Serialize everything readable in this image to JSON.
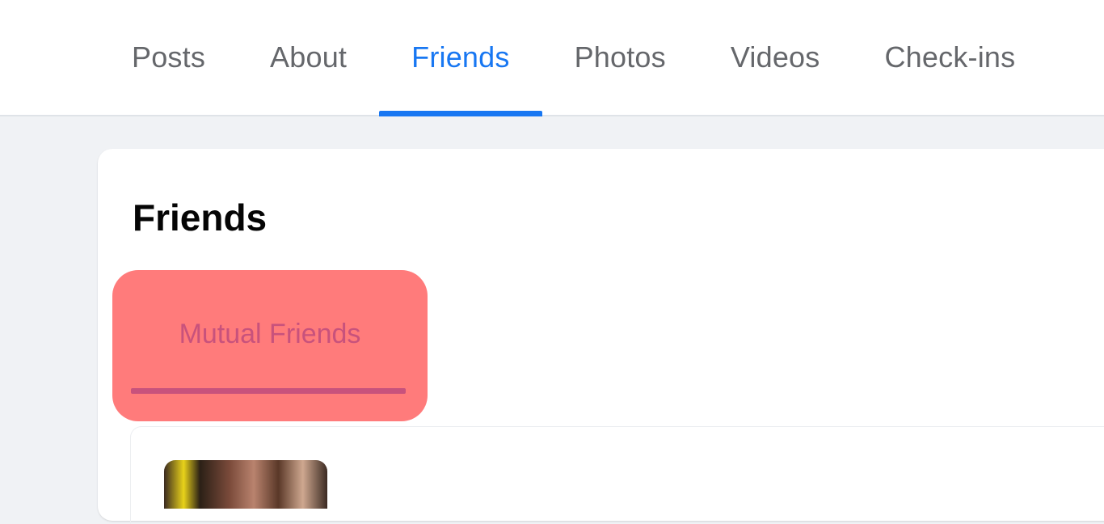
{
  "nav": {
    "tabs": [
      {
        "label": "Posts"
      },
      {
        "label": "About"
      },
      {
        "label": "Friends"
      },
      {
        "label": "Photos"
      },
      {
        "label": "Videos"
      },
      {
        "label": "Check-ins"
      }
    ],
    "active_tab": "Friends",
    "accent_color": "#1877f2"
  },
  "friends_card": {
    "title": "Friends",
    "subtabs": [
      {
        "label": "Mutual Friends"
      }
    ],
    "highlight_color": "#ff7b7b",
    "subtab_text_color": "#c8527c"
  },
  "friend_list": {
    "items": [
      {
        "thumbnail": "friend-photo"
      }
    ]
  }
}
